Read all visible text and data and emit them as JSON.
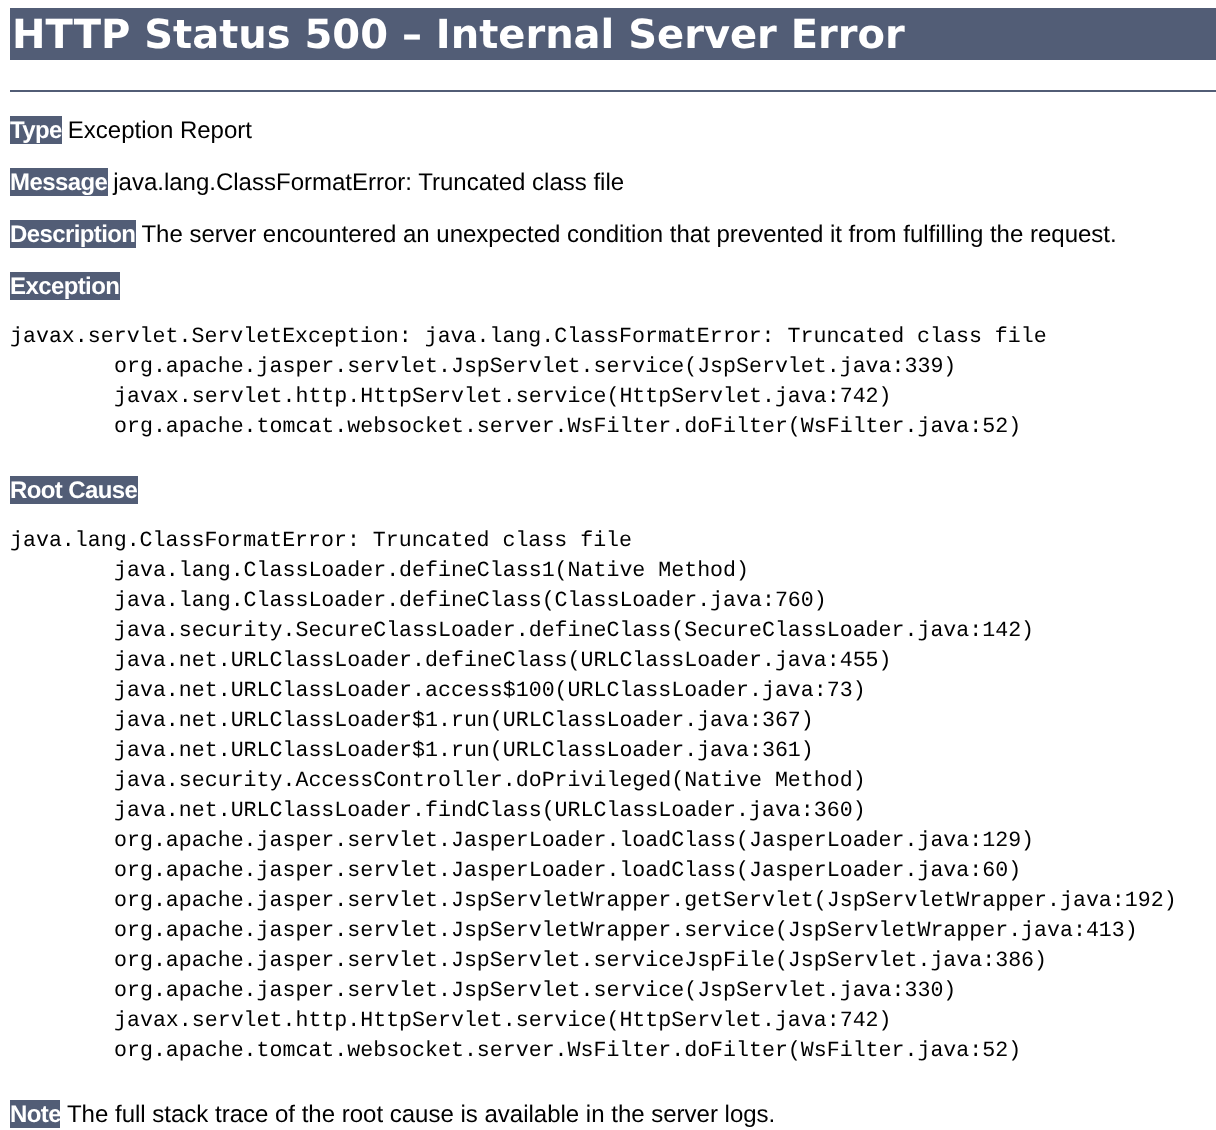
{
  "title": "HTTP Status 500 – Internal Server Error",
  "fields": [
    {
      "label": "Type",
      "value": "Exception Report"
    },
    {
      "label": "Message",
      "value": "java.lang.ClassFormatError: Truncated class file"
    },
    {
      "label": "Description",
      "value": "The server encountered an unexpected condition that prevented it from fulfilling the request."
    }
  ],
  "exception": {
    "label": "Exception",
    "header": "javax.servlet.ServletException: java.lang.ClassFormatError: Truncated class file",
    "frames": [
      "org.apache.jasper.servlet.JspServlet.service(JspServlet.java:339)",
      "javax.servlet.http.HttpServlet.service(HttpServlet.java:742)",
      "org.apache.tomcat.websocket.server.WsFilter.doFilter(WsFilter.java:52)"
    ]
  },
  "root_cause": {
    "label": "Root Cause",
    "header": "java.lang.ClassFormatError: Truncated class file",
    "frames": [
      "java.lang.ClassLoader.defineClass1(Native Method)",
      "java.lang.ClassLoader.defineClass(ClassLoader.java:760)",
      "java.security.SecureClassLoader.defineClass(SecureClassLoader.java:142)",
      "java.net.URLClassLoader.defineClass(URLClassLoader.java:455)",
      "java.net.URLClassLoader.access$100(URLClassLoader.java:73)",
      "java.net.URLClassLoader$1.run(URLClassLoader.java:367)",
      "java.net.URLClassLoader$1.run(URLClassLoader.java:361)",
      "java.security.AccessController.doPrivileged(Native Method)",
      "java.net.URLClassLoader.findClass(URLClassLoader.java:360)",
      "org.apache.jasper.servlet.JasperLoader.loadClass(JasperLoader.java:129)",
      "org.apache.jasper.servlet.JasperLoader.loadClass(JasperLoader.java:60)",
      "org.apache.jasper.servlet.JspServletWrapper.getServlet(JspServletWrapper.java:192)",
      "org.apache.jasper.servlet.JspServletWrapper.service(JspServletWrapper.java:413)",
      "org.apache.jasper.servlet.JspServlet.serviceJspFile(JspServlet.java:386)",
      "org.apache.jasper.servlet.JspServlet.service(JspServlet.java:330)",
      "javax.servlet.http.HttpServlet.service(HttpServlet.java:742)",
      "org.apache.tomcat.websocket.server.WsFilter.doFilter(WsFilter.java:52)"
    ]
  },
  "note": {
    "label": "Note",
    "value": "The full stack trace of the root cause is available in the server logs."
  }
}
